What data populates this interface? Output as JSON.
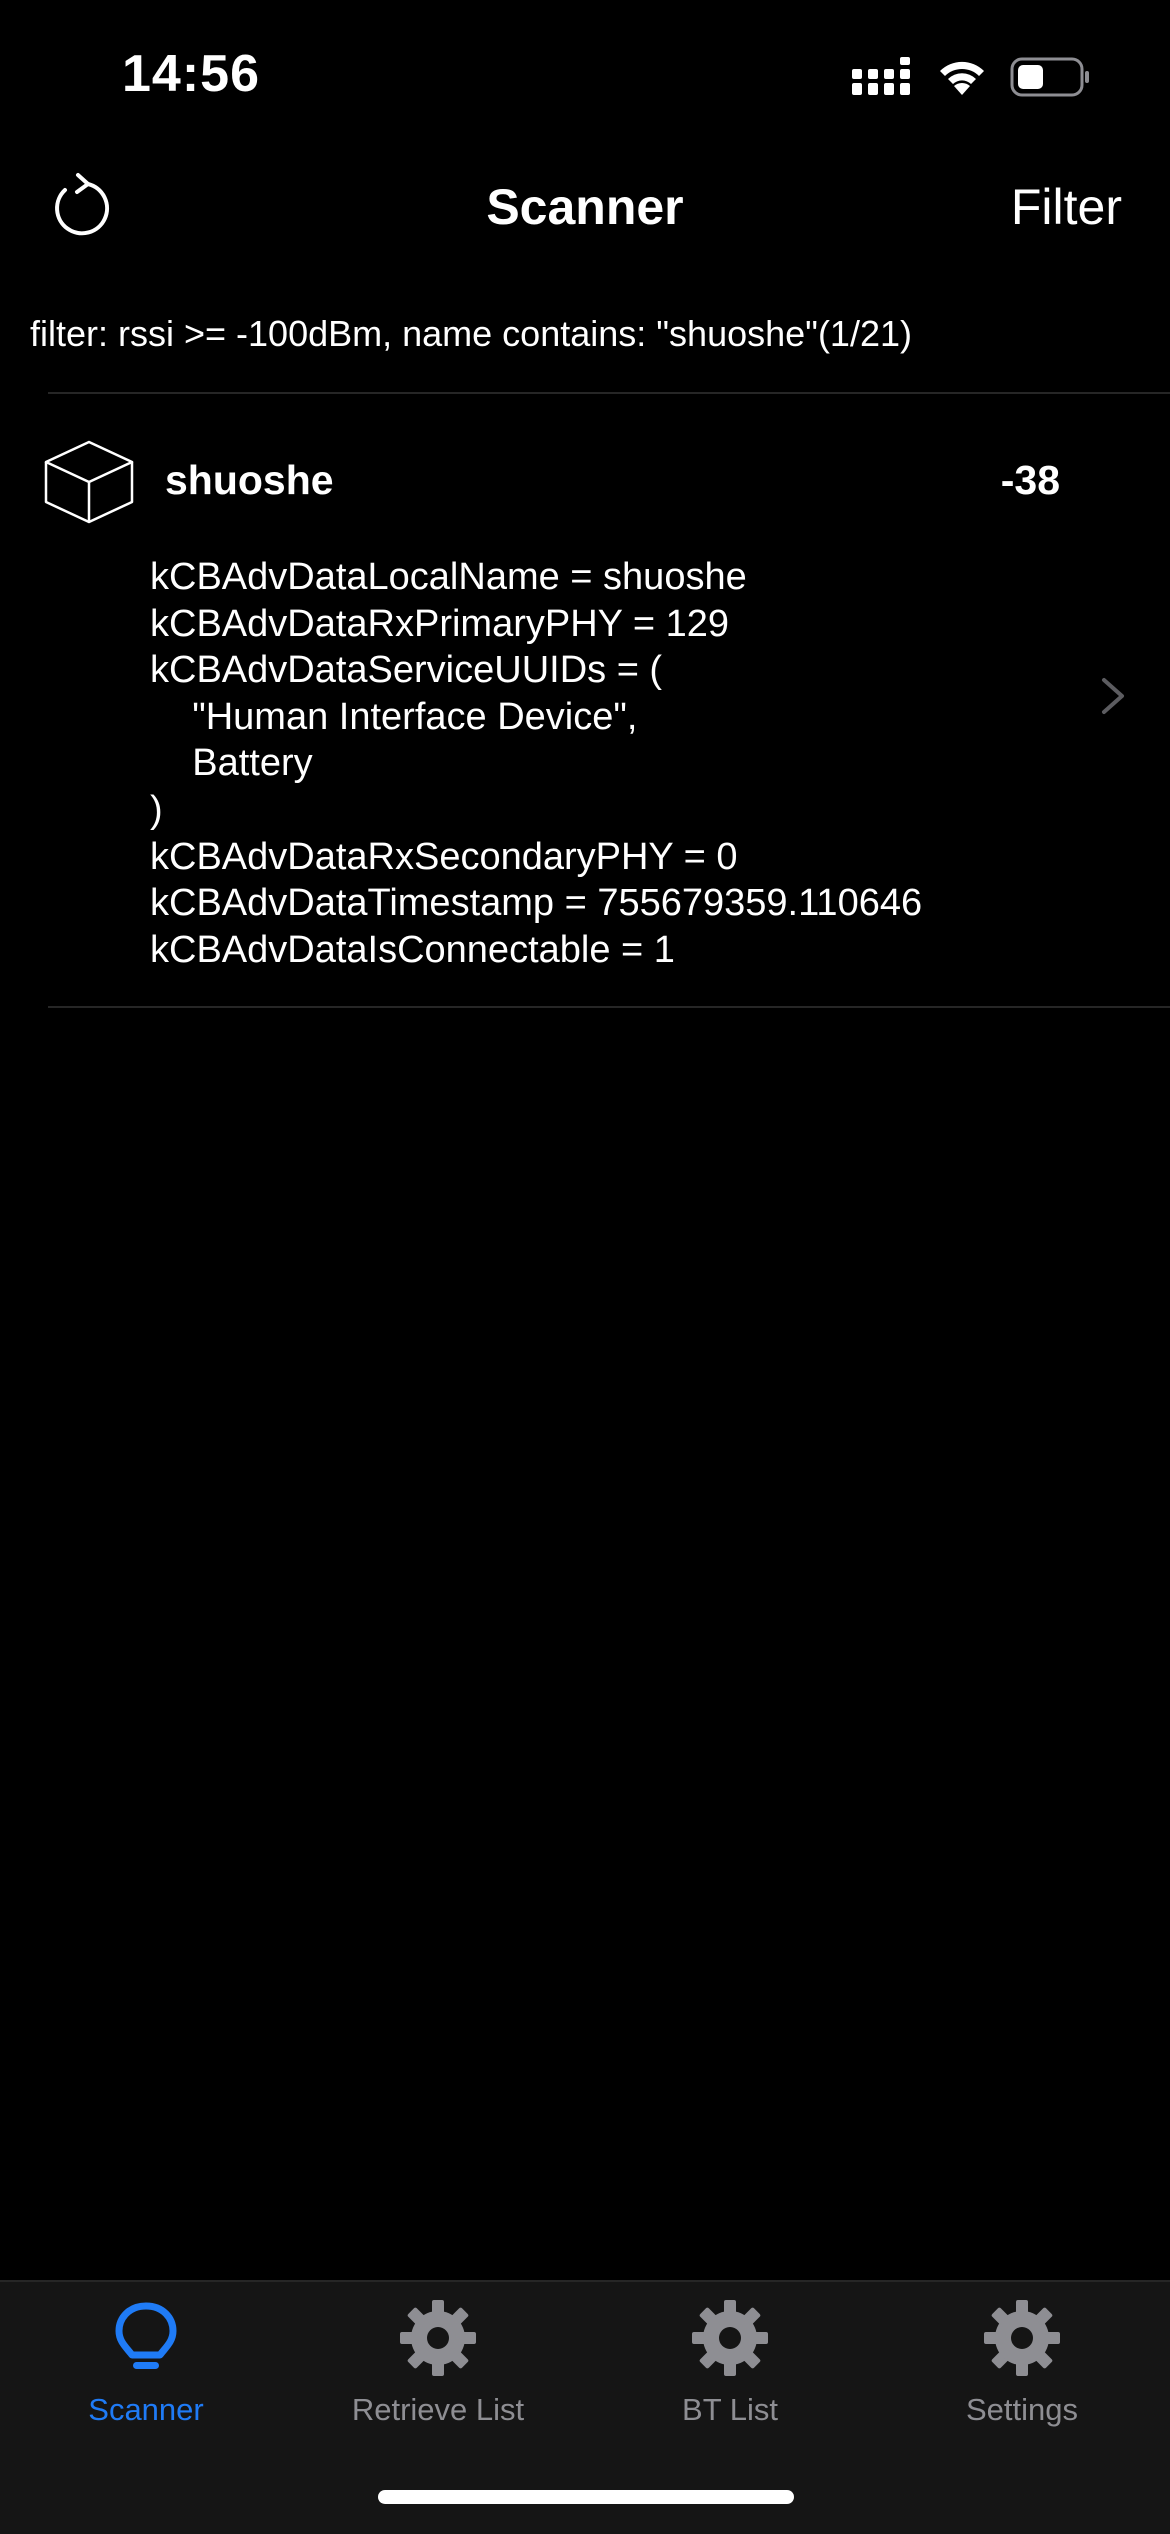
{
  "status_bar": {
    "time": "14:56",
    "icons": [
      "cellular-signal-icon",
      "wifi-icon",
      "battery-icon"
    ]
  },
  "nav": {
    "title": "Scanner",
    "filter_label": "Filter",
    "refresh_icon": "refresh-icon"
  },
  "filter_summary": "filter: rssi >= -100dBm, name contains: \"shuoshe\"(1/21)",
  "devices": [
    {
      "icon": "cube-icon",
      "name": "shuoshe",
      "rssi": "-38",
      "adv_lines": [
        "kCBAdvDataLocalName = shuoshe",
        "kCBAdvDataRxPrimaryPHY = 129",
        "kCBAdvDataServiceUUIDs = (",
        "    \"Human Interface Device\",",
        "    Battery",
        ")",
        "kCBAdvDataRxSecondaryPHY = 0",
        "kCBAdvDataTimestamp = 755679359.110646",
        "kCBAdvDataIsConnectable = 1"
      ]
    }
  ],
  "tabs": [
    {
      "label": "Scanner",
      "icon": "lightbulb-icon",
      "active": true
    },
    {
      "label": "Retrieve List",
      "icon": "gear-icon",
      "active": false
    },
    {
      "label": "BT List",
      "icon": "gear-icon",
      "active": false
    },
    {
      "label": "Settings",
      "icon": "gear-icon",
      "active": false
    }
  ],
  "colors": {
    "background": "#000000",
    "tab_bar_background": "#151515",
    "accent": "#1f7bf6",
    "inactive": "#8e8e93",
    "separator": "#262626"
  }
}
